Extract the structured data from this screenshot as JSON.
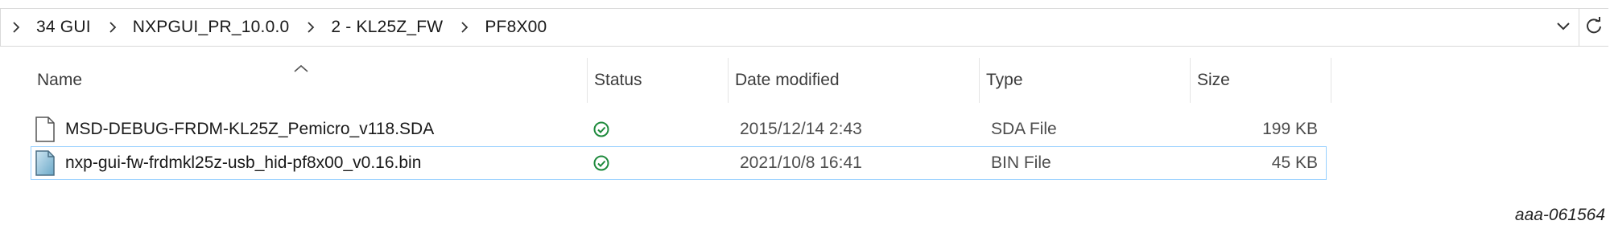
{
  "breadcrumb": {
    "items": [
      "34 GUI",
      "NXPGUI_PR_10.0.0",
      "2 - KL25Z_FW",
      "PF8X00"
    ]
  },
  "columns": {
    "name": "Name",
    "status": "Status",
    "date": "Date modified",
    "type": "Type",
    "size": "Size"
  },
  "files": [
    {
      "name": "MSD-DEBUG-FRDM-KL25Z_Pemicro_v118.SDA",
      "status_icon": "sync-ok-icon",
      "date": "2015/12/14 2:43",
      "type": "SDA File",
      "size": "199 KB",
      "icon": "generic-file-icon"
    },
    {
      "name": "nxp-gui-fw-frdmkl25z-usb_hid-pf8x00_v0.16.bin",
      "status_icon": "sync-ok-icon",
      "date": "2021/10/8 16:41",
      "type": "BIN File",
      "size": "45 KB",
      "icon": "bin-file-icon"
    }
  ],
  "figure_id": "aaa-061564",
  "colors": {
    "status_ok": "#1e8a3c",
    "selection_border": "#99d1ff"
  }
}
